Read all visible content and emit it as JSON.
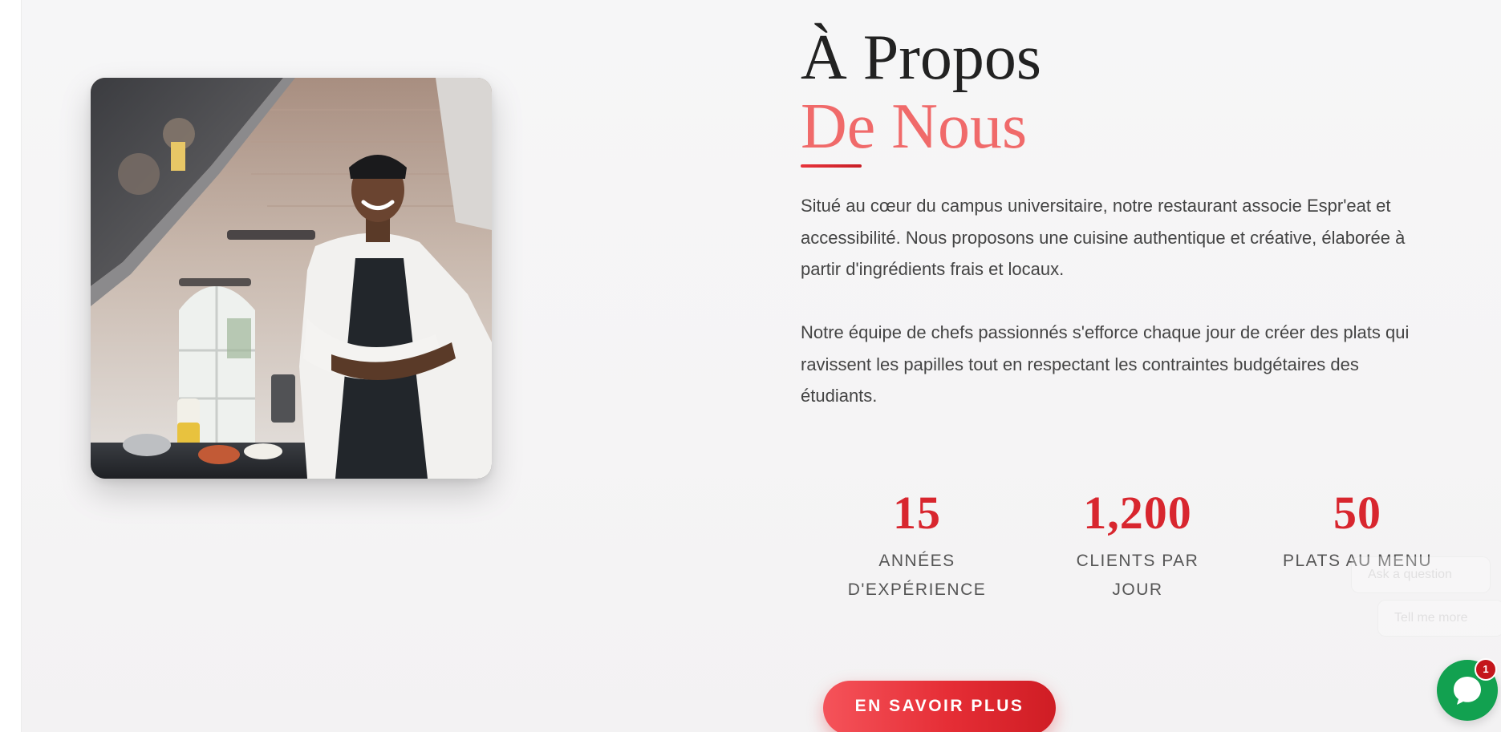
{
  "about": {
    "title_line1": "À Propos",
    "title_line2": "De Nous",
    "paragraphs": [
      "Situé au cœur du campus universitaire, notre restaurant associe Espr'eat et accessibilité. Nous proposons une cuisine authentique et créative, élaborée à partir d'ingrédients frais et locaux.",
      "Notre équipe de chefs passionnés s'efforce chaque jour de créer des plats qui ravissent les papilles tout en respectant les contraintes budgétaires des étudiants."
    ],
    "stats": [
      {
        "number": "15",
        "label": "Années d'expérience"
      },
      {
        "number": "1,200",
        "label": "Clients par jour"
      },
      {
        "number": "50",
        "label": "Plats au menu"
      }
    ],
    "cta_label": "EN SAVOIR PLUS",
    "image_icon": "chef-photo"
  },
  "chat": {
    "suggestions": [
      "Ask a question",
      "Tell me more"
    ],
    "badge_count": "1",
    "launcher_icon": "chat-bubble-icon",
    "launcher_color": "#12a150",
    "badge_color": "#c4161c"
  },
  "colors": {
    "accent": "#d8262e",
    "accent_light": "#f06a6a",
    "text": "#444444",
    "heading": "#222222"
  }
}
